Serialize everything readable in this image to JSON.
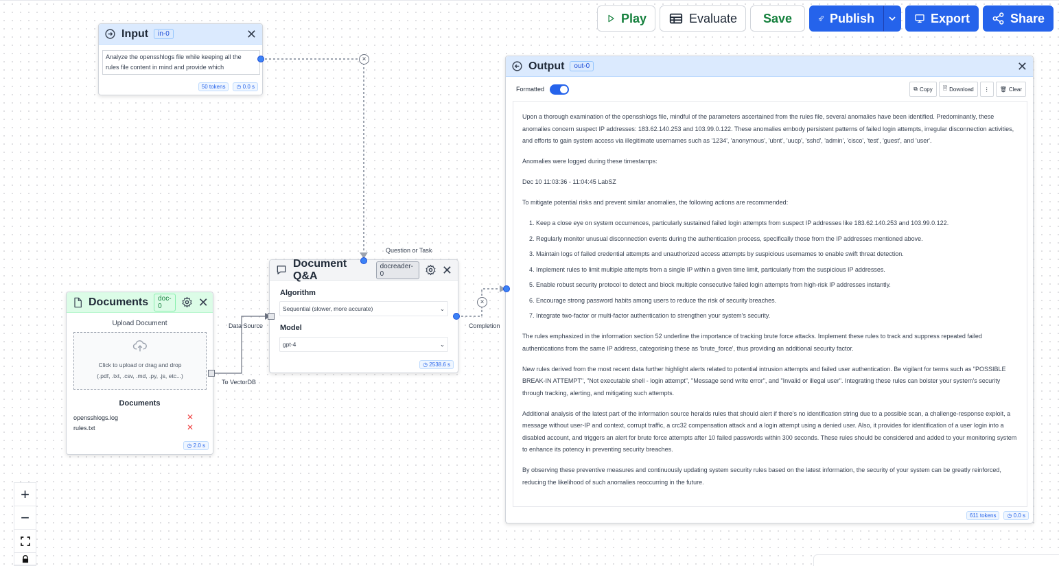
{
  "toolbar": {
    "play": "Play",
    "evaluate": "Evaluate",
    "save": "Save",
    "publish": "Publish",
    "export": "Export",
    "share": "Share"
  },
  "input_node": {
    "title": "Input",
    "tag": "in-0",
    "text": "Analyze the opensshlogs file while keeping all the rules file content in mind and provide which",
    "tokens": "50 tokens",
    "time": "0.0 s"
  },
  "documents_node": {
    "title": "Documents",
    "tag": "doc-0",
    "upload_label": "Upload Document",
    "dropzone_line1": "Click to upload or drag and drop",
    "dropzone_line2": "(.pdf, .txt, .csv, .md, .py, .js, etc...)",
    "list_heading": "Documents",
    "files": [
      "opensshlogs.log",
      "rules.txt"
    ],
    "time": "2.0 s"
  },
  "qa_node": {
    "title": "Document Q&A",
    "tag": "docreader-0",
    "algorithm_label": "Algorithm",
    "algorithm_value": "Sequential (slower, more accurate)",
    "model_label": "Model",
    "model_value": "gpt-4",
    "time": "2538.6 s"
  },
  "edge_labels": {
    "question": "Question or Task",
    "data_source": "Data Source",
    "to_vectordb": "To VectorDB",
    "completion": "Completion"
  },
  "output_node": {
    "title": "Output",
    "tag": "out-0",
    "formatted_label": "Formatted",
    "copy": "Copy",
    "download": "Download",
    "more": "⋮",
    "clear": "Clear",
    "p1": "Upon a thorough examination of the opensshlogs file, mindful of the parameters ascertained from the rules file, several anomalies have been identified. Predominantly, these anomalies concern suspect IP addresses: 183.62.140.253 and 103.99.0.122. These anomalies embody persistent patterns of failed login attempts, irregular disconnection activities, and efforts to gain system access via illegitimate usernames such as '1234', 'anonymous', 'ubnt', 'uucp', 'sshd', 'admin', 'cisco', 'test', 'guest', and 'user'.",
    "p2": "Anomalies were logged during these timestamps:",
    "p3": "Dec 10 11:03:36 - 11:04:45 LabSZ",
    "p4": "To mitigate potential risks and prevent similar anomalies, the following actions are recommended:",
    "list": [
      "Keep a close eye on system occurrences, particularly sustained failed login attempts from suspect IP addresses like 183.62.140.253 and 103.99.0.122.",
      "Regularly monitor unusual disconnection events during the authentication process, specifically those from the IP addresses mentioned above.",
      "Maintain logs of failed credential attempts and unauthorized access attempts by suspicious usernames to enable swift threat detection.",
      "Implement rules to limit multiple attempts from a single IP within a given time limit, particularly from the suspicious IP addresses.",
      "Enable robust security protocol to detect and block multiple consecutive failed login attempts from high-risk IP addresses instantly.",
      "Encourage strong password habits among users to reduce the risk of security breaches.",
      "Integrate two-factor or multi-factor authentication to strengthen your system's security."
    ],
    "p5": "The rules emphasized in the information section 52 underline the importance of tracking brute force attacks. Implement these rules to track and suppress repeated failed authentications from the same IP address, categorising these as 'brute_force', thus providing an additional security factor.",
    "p6": "New rules derived from the most recent data further highlight alerts related to potential intrusion attempts and failed user authentication. Be vigilant for terms such as \"POSSIBLE BREAK-IN ATTEMPT\", \"Not executable shell - login attempt\", \"Message send write error\", and \"Invalid or illegal user\". Integrating these rules can bolster your system's security through tracking, alerting, and mitigating such attempts.",
    "p7": "Additional analysis of the latest part of the information source heralds rules that should alert if there's no identification string due to a possible scan, a challenge-response exploit, a message without user-IP and context, corrupt traffic, a crc32 compensation attack and a login attempt using a denied user. Also, it provides for identification of a user login into a disabled account, and triggers an alert for brute force attempts after 10 failed passwords within 300 seconds. These rules should be considered and added to your monitoring system to enhance its potency in preventing security breaches.",
    "p8": "By observing these preventive measures and continuously updating system security rules based on the latest information, the security of your system can be greatly reinforced, reducing the likelihood of such anomalies reoccurring in the future.",
    "tokens": "611 tokens",
    "time": "0.0 s"
  },
  "zoom": {
    "in": "+",
    "out": "−"
  }
}
